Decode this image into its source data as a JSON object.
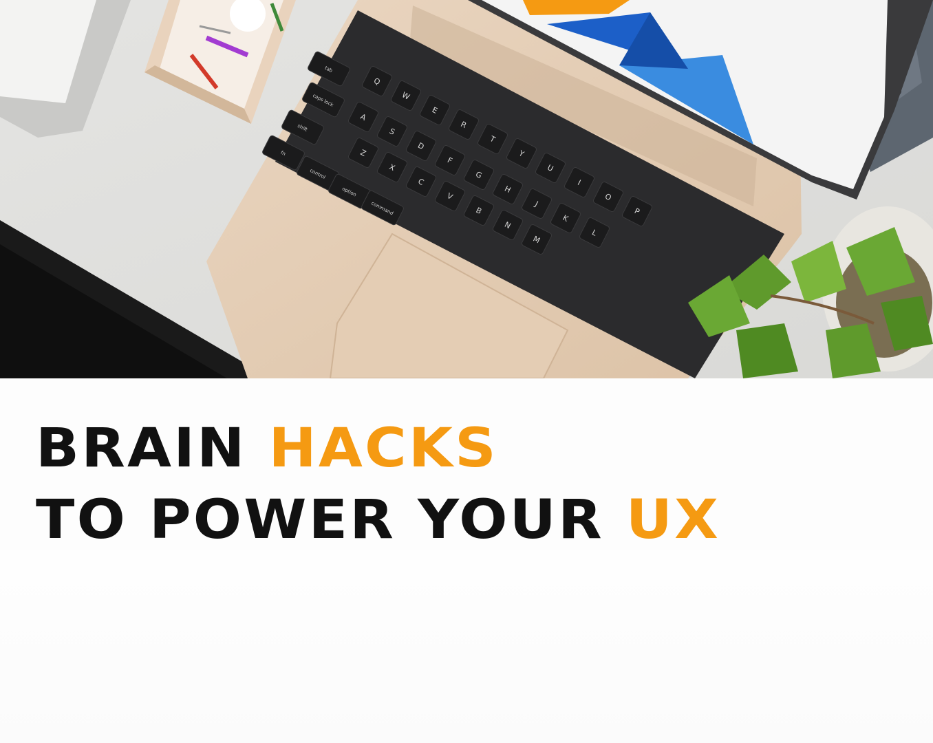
{
  "headline": {
    "line1_part1": "BRAIN ",
    "line1_accent": "HACKS",
    "line2_part1": "TO POWER YOUR ",
    "line2_accent": "UX"
  },
  "colors": {
    "accent": "#f59a12",
    "text": "#111111",
    "background": "#ffffff"
  },
  "keyboard": {
    "rows": [
      [
        "Q",
        "W",
        "E",
        "R",
        "T",
        "Y",
        "U",
        "I",
        "O",
        "P"
      ],
      [
        "A",
        "S",
        "D",
        "F",
        "G",
        "H",
        "J",
        "K",
        "L"
      ],
      [
        "Z",
        "X",
        "C",
        "V",
        "B",
        "N",
        "M"
      ]
    ],
    "mod_keys": [
      "tab",
      "caps lock",
      "shift",
      "fn",
      "control",
      "option",
      "command"
    ]
  }
}
